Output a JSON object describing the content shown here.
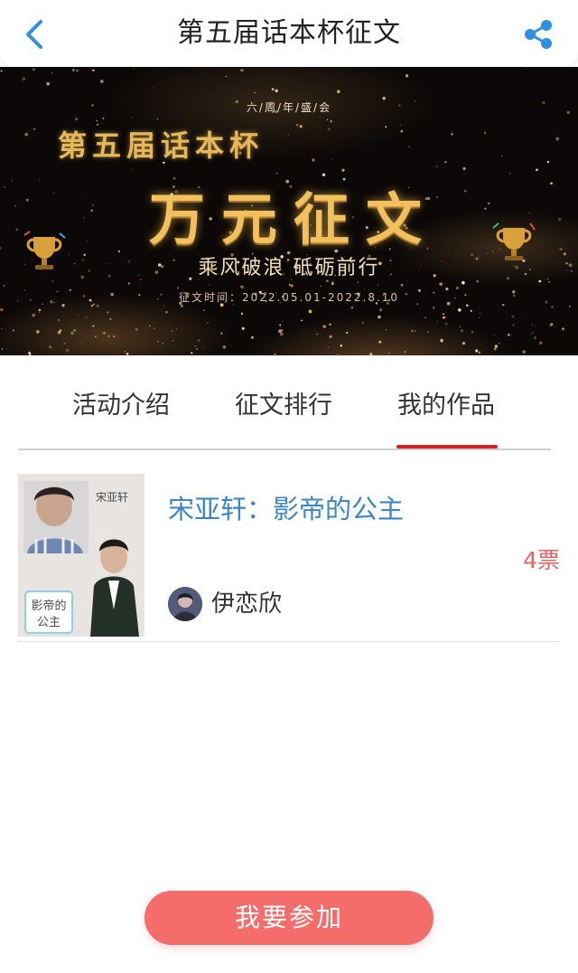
{
  "nav": {
    "title": "第五届话本杯征文",
    "back_icon": "chevron-left-icon",
    "share_icon": "share-icon",
    "accent_color": "#2f8fe0"
  },
  "banner": {
    "small_text": "六/周/年/盛/会",
    "line1": "第五届话本杯",
    "big_text": "万元征文",
    "slogan": "乘风破浪 砥砺前行",
    "date": "征文时间：2022.05.01-2022.8.10",
    "gold_color": "#f2c05e"
  },
  "tabs": {
    "items": [
      {
        "label": "活动介绍",
        "active": false
      },
      {
        "label": "征文排行",
        "active": false
      },
      {
        "label": "我的作品",
        "active": true
      }
    ],
    "active_color": "#d0232a"
  },
  "works": [
    {
      "title": "宋亚轩：影帝的公主",
      "author": "伊恋欣",
      "votes": "4票"
    }
  ],
  "join_button": {
    "label": "我要参加",
    "color": "#f46d6b"
  }
}
